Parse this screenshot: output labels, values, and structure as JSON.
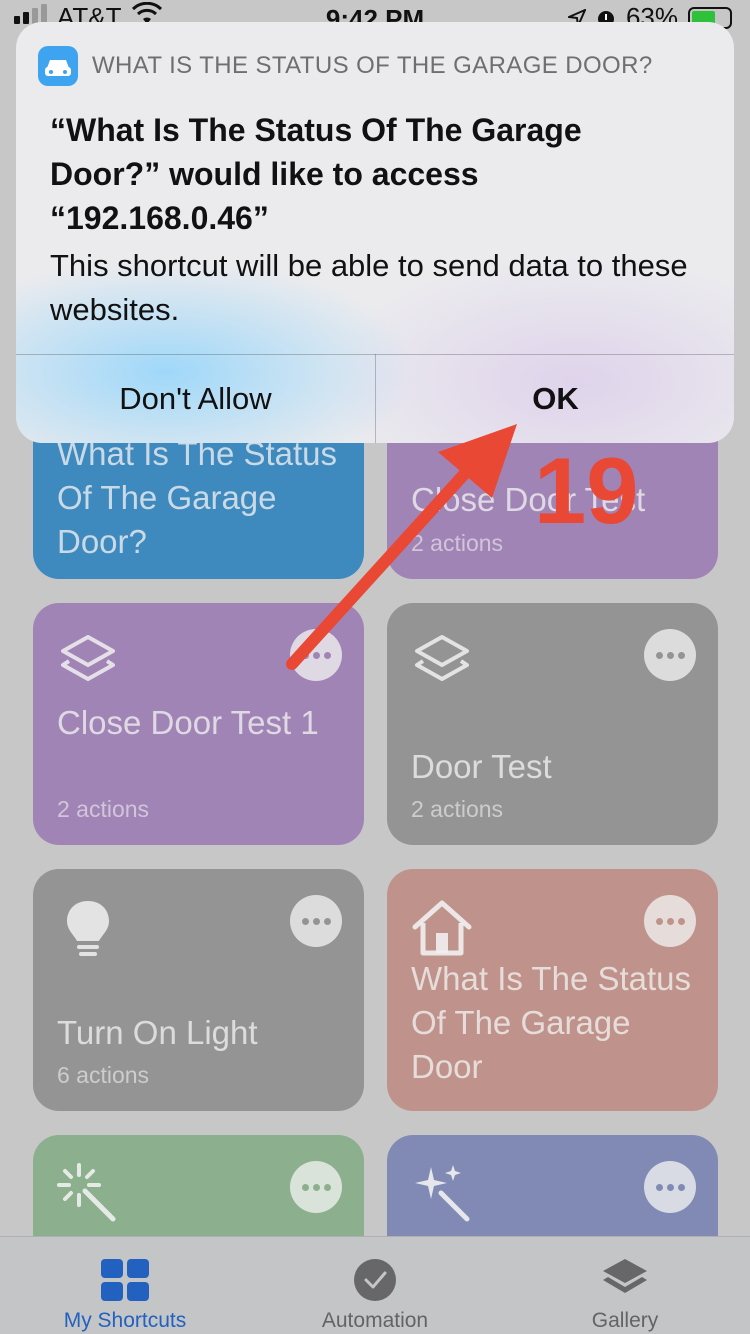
{
  "status_bar": {
    "carrier": "AT&T",
    "time": "9:42 PM",
    "battery": "63%"
  },
  "alert": {
    "header": "WHAT IS THE STATUS OF THE GARAGE DOOR?",
    "title": "“What Is The Status Of The Garage Door?” would like to access “192.168.0.46”",
    "message": "This shortcut will be able to send data to these websites.",
    "deny_label": "Don't Allow",
    "ok_label": "OK"
  },
  "shortcuts": [
    {
      "title": "What Is The Status Of The Garage Door?",
      "subtitle": "",
      "icon": "car-icon",
      "color": "#3d8fc8"
    },
    {
      "title": "Close Door Test",
      "subtitle": "2 actions",
      "icon": "",
      "color": "#a989bf"
    },
    {
      "title": "Close Door Test 1",
      "subtitle": "2 actions",
      "icon": "layers-icon",
      "color": "#a989bf"
    },
    {
      "title": "Door Test",
      "subtitle": "2 actions",
      "icon": "layers-icon",
      "color": "#9b9b9b"
    },
    {
      "title": "Turn On Light",
      "subtitle": "6 actions",
      "icon": "lightbulb-icon",
      "color": "#9b9b9b"
    },
    {
      "title": "What Is The Status Of The Garage Door",
      "subtitle": "",
      "icon": "home-icon",
      "color": "#c99a91"
    },
    {
      "title": "",
      "subtitle": "",
      "icon": "magic-wand-icon",
      "color": "#92b993"
    },
    {
      "title": "",
      "subtitle": "",
      "icon": "sparkles-icon",
      "color": "#8590bd"
    }
  ],
  "tabs": [
    {
      "label": "My Shortcuts",
      "icon": "grid-icon",
      "active": true
    },
    {
      "label": "Automation",
      "icon": "clock-icon",
      "active": false
    },
    {
      "label": "Gallery",
      "icon": "stack-icon",
      "active": false
    }
  ],
  "annotation": {
    "step": "19",
    "color": "#e94834"
  }
}
